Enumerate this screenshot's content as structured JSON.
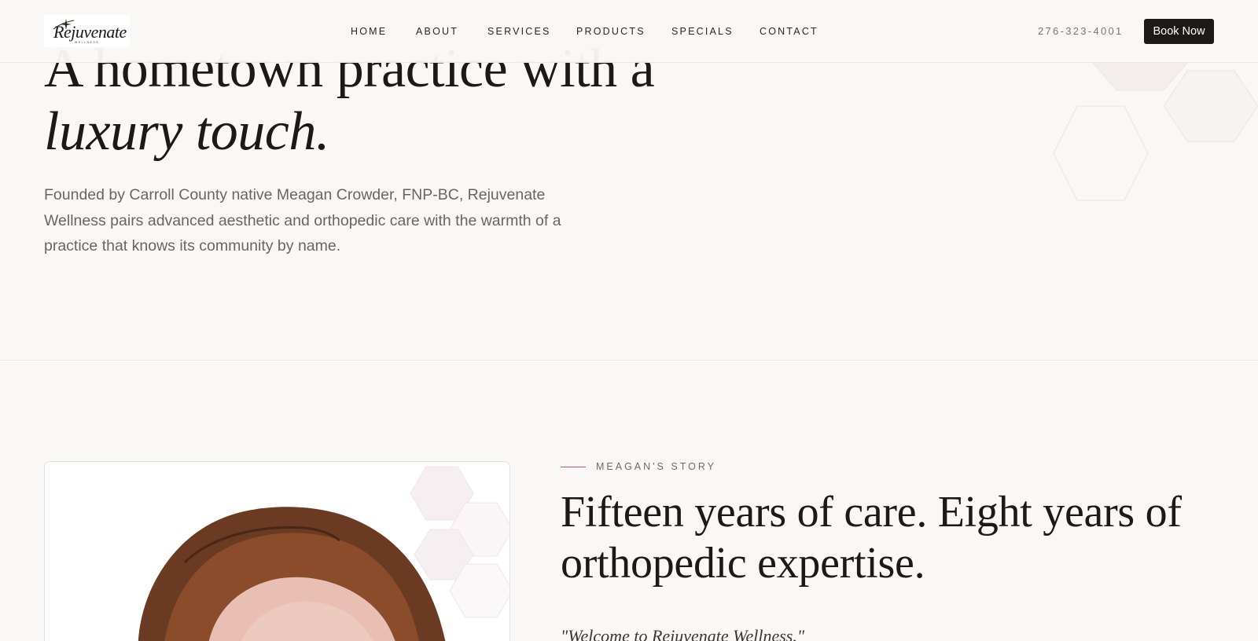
{
  "brand": {
    "logo_word": "Rejuvenate",
    "logo_sub": "WELLNESS"
  },
  "nav": {
    "items": [
      "HOME",
      "ABOUT",
      "SERVICES",
      "PRODUCTS",
      "SPECIALS",
      "CONTACT"
    ]
  },
  "header": {
    "phone": "276-323-4001",
    "book_label": "Book Now"
  },
  "hero": {
    "title_line1": "A hometown practice with a",
    "title_line2": "luxury touch.",
    "lead": "Founded by Carroll County native Meagan Crowder, FNP-BC, Rejuvenate Wellness pairs advanced aesthetic and orthopedic care with the warmth of a practice that knows its community by name."
  },
  "story": {
    "eyebrow": "MEAGAN'S STORY",
    "title": "Fifteen years of care. Eight years of orthopedic expertise.",
    "quote": "\"Welcome to Rejuvenate Wellness.\""
  },
  "colors": {
    "background": "#faf8f6",
    "ink": "#1c1a19",
    "accent_line": "#b0586c",
    "button_bg": "#1c1a19"
  }
}
